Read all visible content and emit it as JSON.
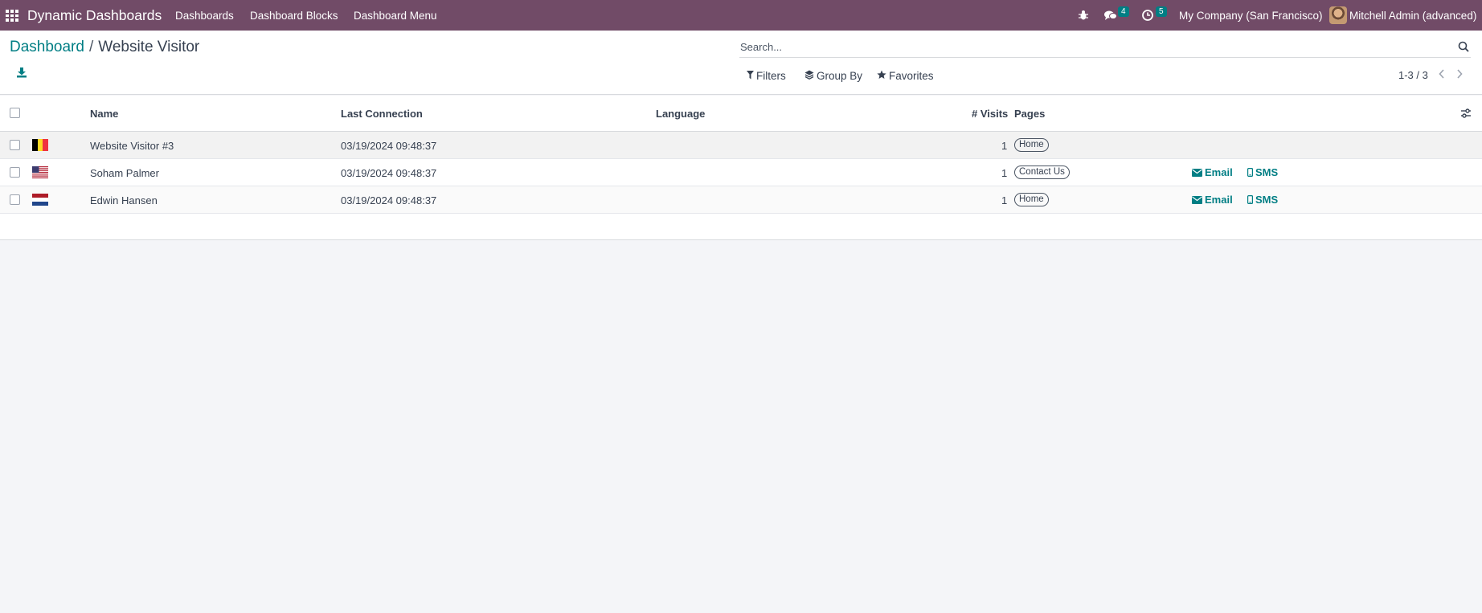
{
  "navbar": {
    "app_name": "Dynamic Dashboards",
    "menu": [
      "Dashboards",
      "Dashboard Blocks",
      "Dashboard Menu"
    ],
    "chat_count": "4",
    "activity_count": "5",
    "company": "My Company (San Francisco)",
    "user": "Mitchell Admin (advanced)",
    "icons": {
      "apps": "apps-grid-icon",
      "debug": "bug-icon",
      "chat": "chat-icon",
      "activity": "clock-icon"
    }
  },
  "breadcrumb": {
    "parent": "Dashboard",
    "separator": "/",
    "current": "Website Visitor"
  },
  "search": {
    "placeholder": "Search..."
  },
  "filters": {
    "filters_label": "Filters",
    "group_by_label": "Group By",
    "favorites_label": "Favorites"
  },
  "pager": {
    "value": "1-3 / 3"
  },
  "table": {
    "columns": [
      "Name",
      "Last Connection",
      "Language",
      "# Visits",
      "Pages"
    ],
    "rows": [
      {
        "country": "Belgium",
        "name": "Website Visitor #3",
        "last_connection": "03/19/2024 09:48:37",
        "language": "",
        "visits": "1",
        "page": "Home",
        "email": "",
        "sms": ""
      },
      {
        "country": "United States",
        "name": "Soham Palmer",
        "last_connection": "03/19/2024 09:48:37",
        "language": "",
        "visits": "1",
        "page": "Contact Us",
        "email": "Email",
        "sms": "SMS"
      },
      {
        "country": "Netherlands",
        "name": "Edwin Hansen",
        "last_connection": "03/19/2024 09:48:37",
        "language": "",
        "visits": "1",
        "page": "Home",
        "email": "Email",
        "sms": "SMS"
      }
    ]
  },
  "colors": {
    "navbar": "#714b67",
    "accent": "#017e84",
    "background": "#f4f5f8"
  }
}
